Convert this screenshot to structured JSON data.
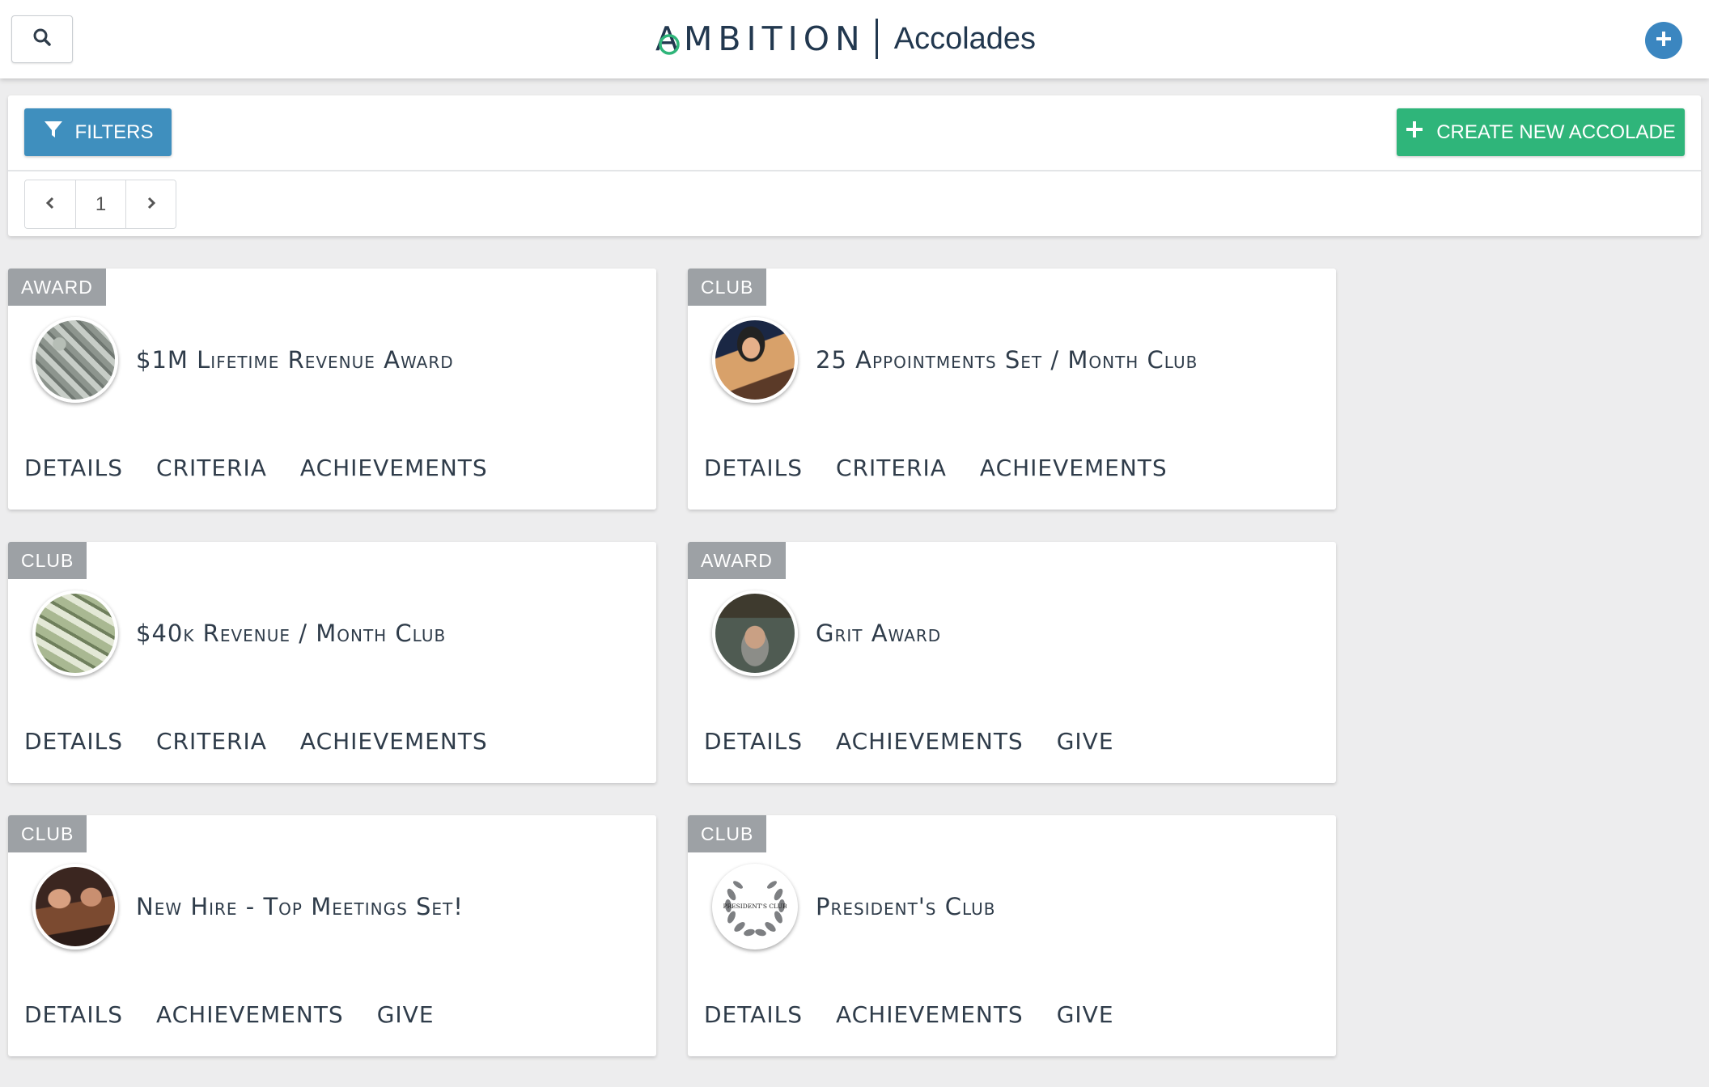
{
  "header": {
    "brand_word": "AMBITION",
    "page_name": "Accolades"
  },
  "toolbar": {
    "filters_label": "FILTERS",
    "create_label": "CREATE NEW ACCOLADE",
    "pagination": {
      "current_page": "1"
    }
  },
  "colors": {
    "brand_green": "#2fb57a",
    "primary_blue": "#3f8fbe",
    "badge_gray": "#9da1a5",
    "brand_navy": "#22384f"
  },
  "cards": [
    {
      "badge": "AWARD",
      "title": "$1M Lifetime Revenue Award",
      "avatar": "money-stacks-image",
      "actions": [
        "DETAILS",
        "CRITERIA",
        "ACHIEVEMENTS"
      ]
    },
    {
      "badge": "CLUB",
      "title": "25 Appointments Set / Month Club",
      "avatar": "man-phone-image",
      "actions": [
        "DETAILS",
        "CRITERIA",
        "ACHIEVEMENTS"
      ]
    },
    {
      "badge": "CLUB",
      "title": "$40k Revenue / Month Club",
      "avatar": "dollar-bills-image",
      "actions": [
        "DETAILS",
        "CRITERIA",
        "ACHIEVEMENTS"
      ]
    },
    {
      "badge": "AWARD",
      "title": "Grit Award",
      "avatar": "cowboy-image",
      "actions": [
        "DETAILS",
        "ACHIEVEMENTS",
        "GIVE"
      ]
    },
    {
      "badge": "CLUB",
      "title": "New Hire - Top Meetings Set!",
      "avatar": "men-celebrating-image",
      "actions": [
        "DETAILS",
        "ACHIEVEMENTS",
        "GIVE"
      ]
    },
    {
      "badge": "CLUB",
      "title": "President's Club",
      "avatar": "presidents-club-laurel-logo",
      "avatar_text": "PRESIDENT'S CLUB",
      "actions": [
        "DETAILS",
        "ACHIEVEMENTS",
        "GIVE"
      ]
    }
  ]
}
